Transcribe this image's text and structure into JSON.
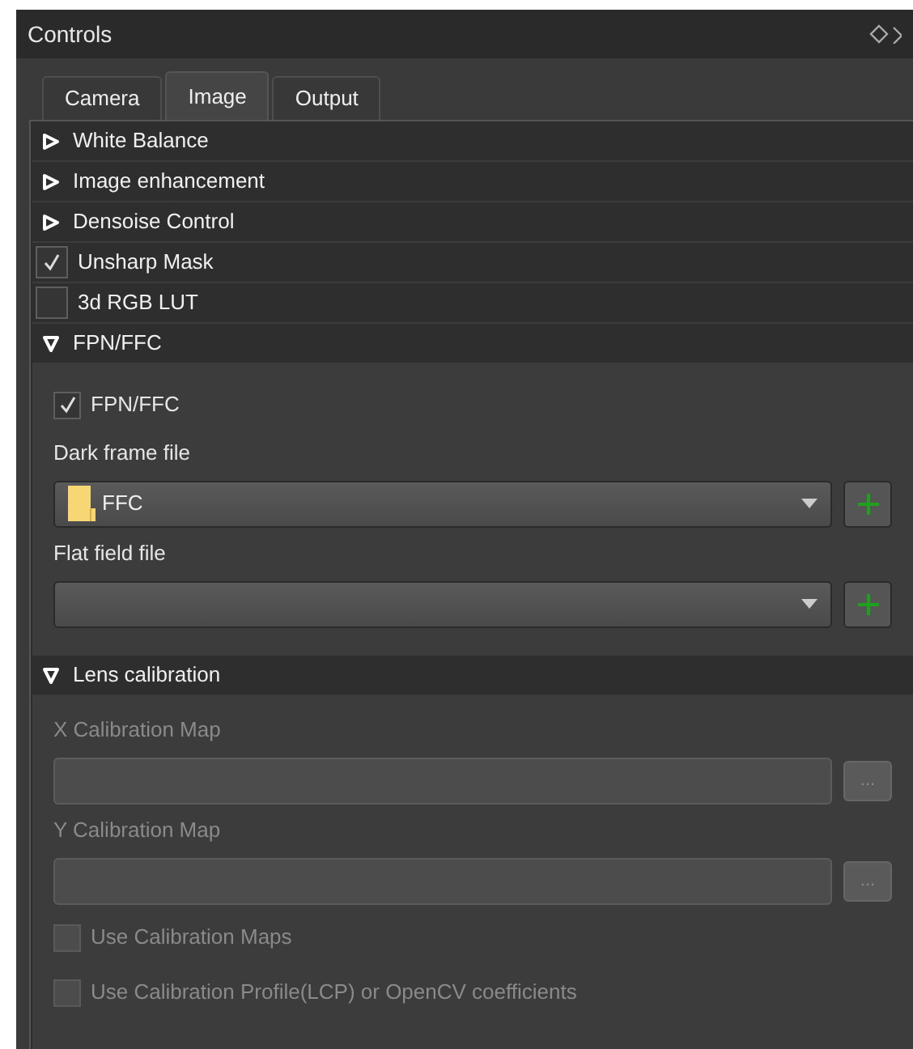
{
  "panel": {
    "title": "Controls"
  },
  "tabs": [
    {
      "label": "Camera",
      "selected": false
    },
    {
      "label": "Image",
      "selected": true
    },
    {
      "label": "Output",
      "selected": false
    }
  ],
  "sections": [
    {
      "kind": "group",
      "label": "White Balance",
      "expanded": false
    },
    {
      "kind": "group",
      "label": "Image enhancement",
      "expanded": false
    },
    {
      "kind": "group",
      "label": "Densoise Control",
      "expanded": false
    },
    {
      "kind": "check",
      "label": "Unsharp Mask",
      "checked": true
    },
    {
      "kind": "check",
      "label": "3d RGB LUT",
      "checked": false
    },
    {
      "kind": "group",
      "label": "FPN/FFC",
      "expanded": true,
      "disabled": false,
      "content": [
        {
          "kind": "checkbox",
          "label": "FPN/FFC",
          "checked": true
        },
        {
          "kind": "label",
          "text": "Dark frame file"
        },
        {
          "kind": "combo",
          "value": "FFC"
        },
        {
          "kind": "label",
          "text": "Flat field file"
        },
        {
          "kind": "combo"
        }
      ]
    },
    {
      "kind": "group",
      "label": "Lens calibration",
      "expanded": true,
      "disabled": true,
      "content": [
        {
          "kind": "label",
          "text": "X Calibration Map"
        },
        {
          "kind": "path",
          "button": "..."
        },
        {
          "kind": "label",
          "text": "Y Calibration Map"
        },
        {
          "kind": "path",
          "button": "..."
        },
        {
          "kind": "checkbox",
          "label": "Use Calibration Maps",
          "checked": false
        },
        {
          "kind": "checkbox",
          "label": "Use Calibration Profile(LCP) or OpenCV coefficients",
          "checked": false
        }
      ]
    }
  ]
}
